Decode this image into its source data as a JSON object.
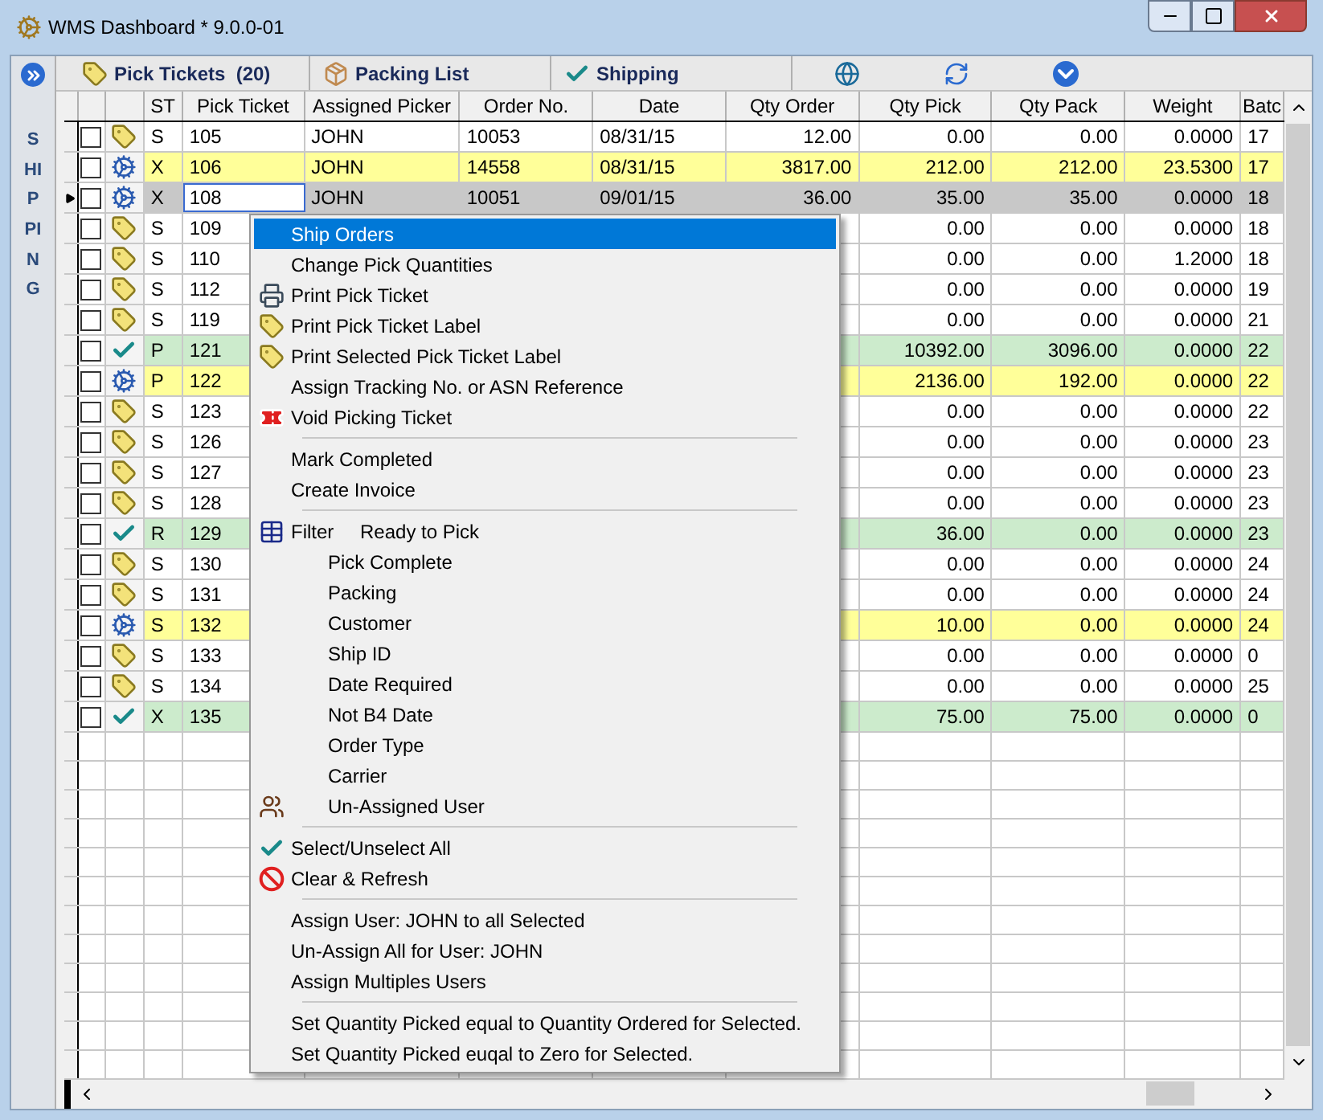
{
  "window": {
    "title": "WMS Dashboard * 9.0.0-01"
  },
  "sidebar": {
    "label": "SHIPPING"
  },
  "toolbar": {
    "tabs": [
      {
        "label": "Pick Tickets  (20)"
      },
      {
        "label": "Packing List"
      },
      {
        "label": "Shipping"
      }
    ]
  },
  "table": {
    "columns": [
      "ST",
      "Pick Ticket",
      "Assigned Picker",
      "Order No.",
      "Date",
      "Qty Order",
      "Qty Pick",
      "Qty Pack",
      "Weight",
      "Batc"
    ],
    "rows": [
      {
        "kind": "tag",
        "color": "#ffffff",
        "current": false,
        "checked": false,
        "cells": [
          "S",
          "105",
          "JOHN",
          "10053",
          "08/31/15",
          "12.00",
          "0.00",
          "0.00",
          "0.0000",
          "17"
        ]
      },
      {
        "kind": "gears",
        "color": "#ffff99",
        "current": false,
        "checked": false,
        "cells": [
          "X",
          "106",
          "JOHN",
          "14558",
          "08/31/15",
          "3817.00",
          "212.00",
          "212.00",
          "23.5300",
          "17"
        ]
      },
      {
        "kind": "gears",
        "color": "#c8c8c8",
        "current": true,
        "checked": false,
        "cells": [
          "X",
          "108",
          "JOHN",
          "10051",
          "09/01/15",
          "36.00",
          "35.00",
          "35.00",
          "0.0000",
          "18"
        ]
      },
      {
        "kind": "tag",
        "color": "#ffffff",
        "current": false,
        "checked": false,
        "cells": [
          "S",
          "109",
          "",
          "",
          "",
          "",
          "0.00",
          "0.00",
          "0.0000",
          "18"
        ]
      },
      {
        "kind": "tag",
        "color": "#ffffff",
        "current": false,
        "checked": false,
        "cells": [
          "S",
          "110",
          "",
          "",
          "",
          "",
          "0.00",
          "0.00",
          "1.2000",
          "18"
        ]
      },
      {
        "kind": "tag",
        "color": "#ffffff",
        "current": false,
        "checked": false,
        "cells": [
          "S",
          "112",
          "",
          "",
          "",
          "",
          "0.00",
          "0.00",
          "0.0000",
          "19"
        ]
      },
      {
        "kind": "tag",
        "color": "#ffffff",
        "current": false,
        "checked": false,
        "cells": [
          "S",
          "119",
          "",
          "",
          "",
          "",
          "0.00",
          "0.00",
          "0.0000",
          "21"
        ]
      },
      {
        "kind": "check",
        "color": "#ccebcc",
        "current": false,
        "checked": false,
        "cells": [
          "P",
          "121",
          "",
          "",
          "",
          "",
          "10392.00",
          "3096.00",
          "0.0000",
          "22"
        ]
      },
      {
        "kind": "gears",
        "color": "#ffff99",
        "current": false,
        "checked": false,
        "cells": [
          "P",
          "122",
          "",
          "",
          "",
          "",
          "2136.00",
          "192.00",
          "0.0000",
          "22"
        ]
      },
      {
        "kind": "tag",
        "color": "#ffffff",
        "current": false,
        "checked": false,
        "cells": [
          "S",
          "123",
          "",
          "",
          "",
          "",
          "0.00",
          "0.00",
          "0.0000",
          "22"
        ]
      },
      {
        "kind": "tag",
        "color": "#ffffff",
        "current": false,
        "checked": false,
        "cells": [
          "S",
          "126",
          "",
          "",
          "",
          "",
          "0.00",
          "0.00",
          "0.0000",
          "23"
        ]
      },
      {
        "kind": "tag",
        "color": "#ffffff",
        "current": false,
        "checked": false,
        "cells": [
          "S",
          "127",
          "",
          "",
          "",
          "",
          "0.00",
          "0.00",
          "0.0000",
          "23"
        ]
      },
      {
        "kind": "tag",
        "color": "#ffffff",
        "current": false,
        "checked": false,
        "cells": [
          "S",
          "128",
          "",
          "",
          "",
          "",
          "0.00",
          "0.00",
          "0.0000",
          "23"
        ]
      },
      {
        "kind": "check",
        "color": "#ccebcc",
        "current": false,
        "checked": false,
        "cells": [
          "R",
          "129",
          "",
          "",
          "",
          "",
          "36.00",
          "0.00",
          "0.0000",
          "23"
        ]
      },
      {
        "kind": "tag",
        "color": "#ffffff",
        "current": false,
        "checked": false,
        "cells": [
          "S",
          "130",
          "",
          "",
          "",
          "",
          "0.00",
          "0.00",
          "0.0000",
          "24"
        ]
      },
      {
        "kind": "tag",
        "color": "#ffffff",
        "current": false,
        "checked": false,
        "cells": [
          "S",
          "131",
          "",
          "",
          "",
          "",
          "0.00",
          "0.00",
          "0.0000",
          "24"
        ]
      },
      {
        "kind": "gears",
        "color": "#ffff99",
        "current": false,
        "checked": false,
        "cells": [
          "S",
          "132",
          "",
          "",
          "",
          "",
          "10.00",
          "0.00",
          "0.0000",
          "24"
        ]
      },
      {
        "kind": "tag",
        "color": "#ffffff",
        "current": false,
        "checked": false,
        "cells": [
          "S",
          "133",
          "",
          "",
          "",
          "",
          "0.00",
          "0.00",
          "0.0000",
          "0"
        ]
      },
      {
        "kind": "tag",
        "color": "#ffffff",
        "current": false,
        "checked": false,
        "cells": [
          "S",
          "134",
          "",
          "",
          "",
          "",
          "0.00",
          "0.00",
          "0.0000",
          "25"
        ]
      },
      {
        "kind": "check",
        "color": "#ccebcc",
        "current": false,
        "checked": false,
        "cells": [
          "X",
          "135",
          "",
          "",
          "",
          "",
          "75.00",
          "75.00",
          "0.0000",
          "0"
        ]
      }
    ]
  },
  "context_menu": {
    "items": [
      {
        "kind": "item",
        "label": "Ship Orders",
        "selected": true
      },
      {
        "kind": "item",
        "label": "Change Pick Quantities",
        "selected": false
      },
      {
        "kind": "printer",
        "label": "Print Pick Ticket",
        "selected": false
      },
      {
        "kind": "tag",
        "label": "Print Pick Ticket Label",
        "selected": false
      },
      {
        "kind": "tag",
        "label": "Print Selected Pick Ticket Label",
        "selected": false
      },
      {
        "kind": "item",
        "label": "Assign Tracking No. or ASN Reference",
        "selected": false
      },
      {
        "kind": "void",
        "label": "Void Picking Ticket",
        "selected": false
      },
      {
        "kind": "separator"
      },
      {
        "kind": "item",
        "label": "Mark Completed",
        "selected": false
      },
      {
        "kind": "item",
        "label": "Create Invoice",
        "selected": false
      },
      {
        "kind": "separator"
      },
      {
        "kind": "filter",
        "prefix": "Filter",
        "label": "Ready to Pick",
        "selected": false
      },
      {
        "kind": "subitem",
        "label": "Pick Complete",
        "selected": false
      },
      {
        "kind": "subitem",
        "label": "Packing",
        "selected": false
      },
      {
        "kind": "subitem",
        "label": "Customer",
        "selected": false
      },
      {
        "kind": "subitem",
        "label": "Ship ID",
        "selected": false
      },
      {
        "kind": "subitem",
        "label": "Date Required",
        "selected": false
      },
      {
        "kind": "subitem",
        "label": "Not B4 Date",
        "selected": false
      },
      {
        "kind": "subitem",
        "label": "Order Type",
        "selected": false
      },
      {
        "kind": "subitem",
        "label": "Carrier",
        "selected": false
      },
      {
        "kind": "users",
        "label": "Un-Assigned User",
        "selected": false
      },
      {
        "kind": "separator"
      },
      {
        "kind": "check",
        "label": "Select/Unselect All",
        "selected": false
      },
      {
        "kind": "ban",
        "label": "Clear & Refresh",
        "selected": false
      },
      {
        "kind": "separator"
      },
      {
        "kind": "item",
        "label": "Assign User: JOHN to all Selected",
        "selected": false
      },
      {
        "kind": "item",
        "label": "Un-Assign All for User: JOHN",
        "selected": false
      },
      {
        "kind": "item",
        "label": "Assign Multiples Users",
        "selected": false
      },
      {
        "kind": "separator"
      },
      {
        "kind": "item",
        "label": "Set Quantity Picked equal to Quantity Ordered for Selected.",
        "selected": false
      },
      {
        "kind": "item",
        "label": "Set Quantity Picked euqal to Zero for Selected.",
        "selected": false
      }
    ]
  }
}
